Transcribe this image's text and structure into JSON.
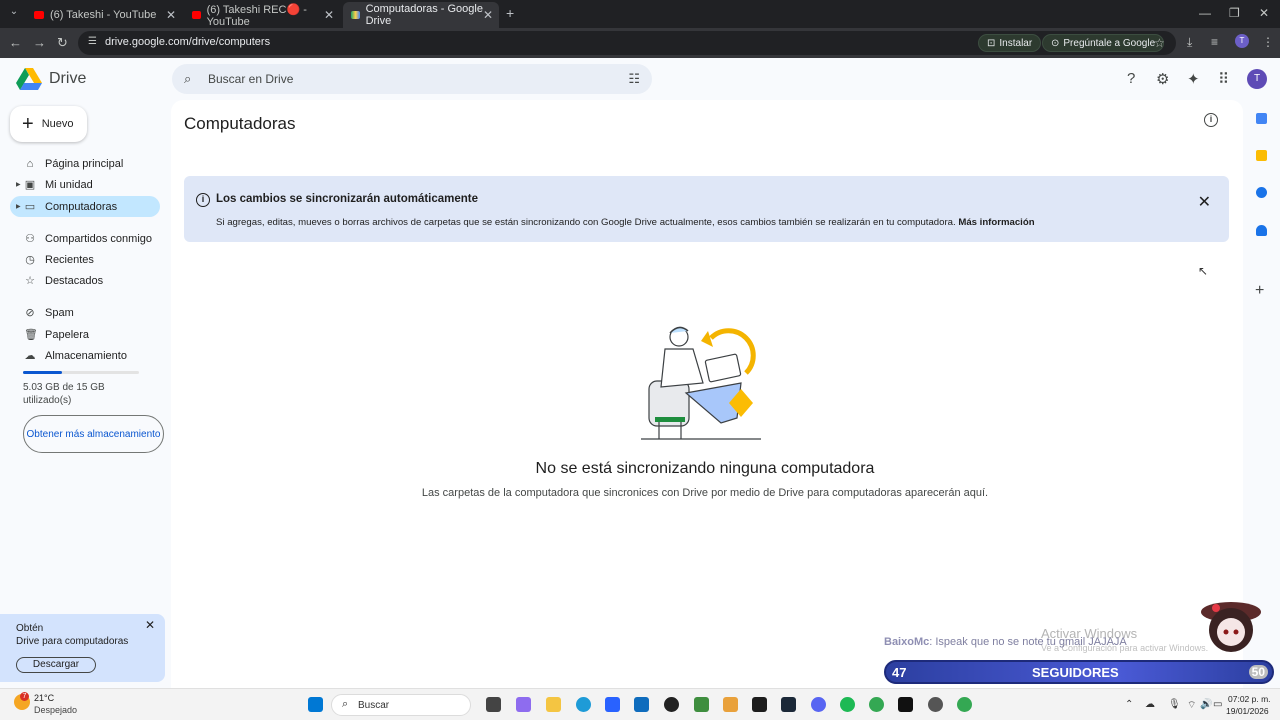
{
  "browser": {
    "tabs": [
      {
        "label": "(6) Takeshi - YouTube"
      },
      {
        "label": "(6) Takeshi REC🔴 - YouTube"
      },
      {
        "label": "Computadoras - Google Drive"
      }
    ],
    "url": "drive.google.com/drive/computers",
    "install_label": "Instalar",
    "ask_google_label": "Pregúntale a Google",
    "profile_initial": "T"
  },
  "drive": {
    "logo_text": "Drive",
    "search_placeholder": "Buscar en Drive",
    "avatar_initial": "T",
    "new_label": "Nuevo",
    "nav": [
      {
        "label": "Página principal",
        "icon": "home-icon"
      },
      {
        "label": "Mi unidad",
        "icon": "drive-icon"
      },
      {
        "label": "Computadoras",
        "icon": "computer-icon"
      },
      {
        "label": "Compartidos conmigo",
        "icon": "people-icon"
      },
      {
        "label": "Recientes",
        "icon": "clock-icon"
      },
      {
        "label": "Destacados",
        "icon": "star-icon"
      },
      {
        "label": "Spam",
        "icon": "spam-icon"
      },
      {
        "label": "Papelera",
        "icon": "trash-icon"
      },
      {
        "label": "Almacenamiento",
        "icon": "cloud-icon"
      }
    ],
    "storage": {
      "used_text": "5.03 GB de 15 GB utilizado(s)",
      "used_fraction": 0.335,
      "button_label": "Obtener más almacenamiento"
    },
    "promo": {
      "line1": "Obtén",
      "line2": "Drive para computadoras",
      "button_label": "Descargar"
    },
    "page_title": "Computadoras",
    "banner": {
      "title": "Los cambios se sincronizarán automáticamente",
      "description": "Si agregas, editas, mueves o borras archivos de carpetas que se están sincronizando con Google Drive actualmente, esos cambios también se realizarán en tu computadora.",
      "link": "Más información"
    },
    "empty": {
      "title": "No se está sincronizando ninguna computadora",
      "description": "Las carpetas de la computadora que sincronices con Drive por medio de Drive para computadoras aparecerán aquí."
    }
  },
  "overlay": {
    "watermark_title": "Activar Windows",
    "watermark_sub": "Ve a Configuración para activar Windows.",
    "chat_user": "BaixoMc",
    "chat_message": ": Ispeak que no se note tu gmail JAJAJA",
    "followers_count": "47",
    "followers_label": "SEGUIDORES",
    "followers_goal": "50"
  },
  "taskbar": {
    "temperature": "21°C",
    "weather": "Despejado",
    "search_label": "Buscar",
    "time": "07:02 p. m.",
    "date": "19/01/2026",
    "weather_badge": "7"
  },
  "colors": {
    "accent_blue": "#0b57d0",
    "nav_active": "#c2e7ff",
    "banner_bg": "#dfe7f7"
  }
}
